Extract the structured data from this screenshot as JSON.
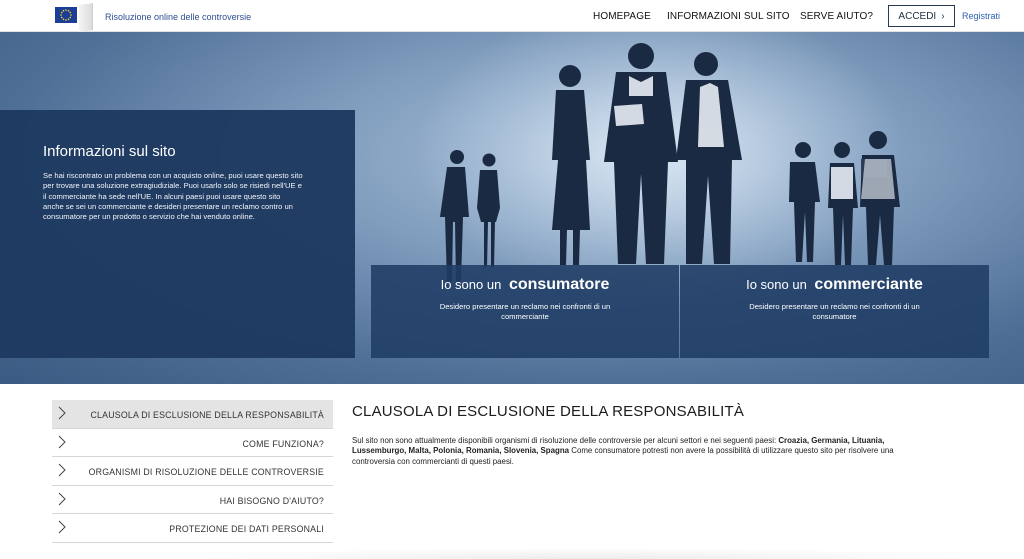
{
  "header": {
    "site_name": "Risoluzione online delle controversie",
    "nav": [
      "HOMEPAGE",
      "INFORMAZIONI SUL SITO",
      "SERVE AIUTO?"
    ],
    "login_label": "ACCEDI",
    "register_label": "Registrati",
    "brand_color": "#1b3f96"
  },
  "hero": {
    "info_title": "Informazioni sul sito",
    "info_text": "Se hai riscontrato un problema con un acquisto online, puoi usare questo sito per trovare una soluzione extragiudiziale. Puoi usarlo solo se risiedi nell'UE e il commerciante ha sede nell'UE. In alcuni paesi puoi usare questo sito anche se sei un commerciante e desideri presentare un reclamo contro un consumatore per un prodotto o servizio che hai venduto online.",
    "cards": [
      {
        "prefix": "Io sono un",
        "role": "consumatore",
        "text": "Desidero presentare un reclamo nei confronti di un commerciante"
      },
      {
        "prefix": "Io sono un",
        "role": "commerciante",
        "text": "Desidero presentare un reclamo nei confronti di un consumatore"
      }
    ]
  },
  "sidebar": {
    "items": [
      "CLAUSOLA DI ESCLUSIONE DELLA RESPONSABILITÀ",
      "COME FUNZIONA?",
      "ORGANISMI DI RISOLUZIONE DELLE CONTROVERSIE",
      "HAI BISOGNO D'AIUTO?",
      "PROTEZIONE DEI DATI PERSONALI"
    ],
    "active_index": 0
  },
  "main": {
    "title": "CLAUSOLA DI ESCLUSIONE DELLA RESPONSABILITÀ",
    "text_intro": "Sul sito non sono attualmente disponibili organismi di risoluzione delle controversie per alcuni settori e nei seguenti paesi: ",
    "countries": "Croazia, Germania, Lituania, Lussemburgo, Malta, Polonia, Romania, Slovenia, Spagna",
    "text_outro": " Come consumatore potresti non avere la possibilità di utilizzare questo sito per risolvere una controversia con commercianti di questi paesi."
  }
}
